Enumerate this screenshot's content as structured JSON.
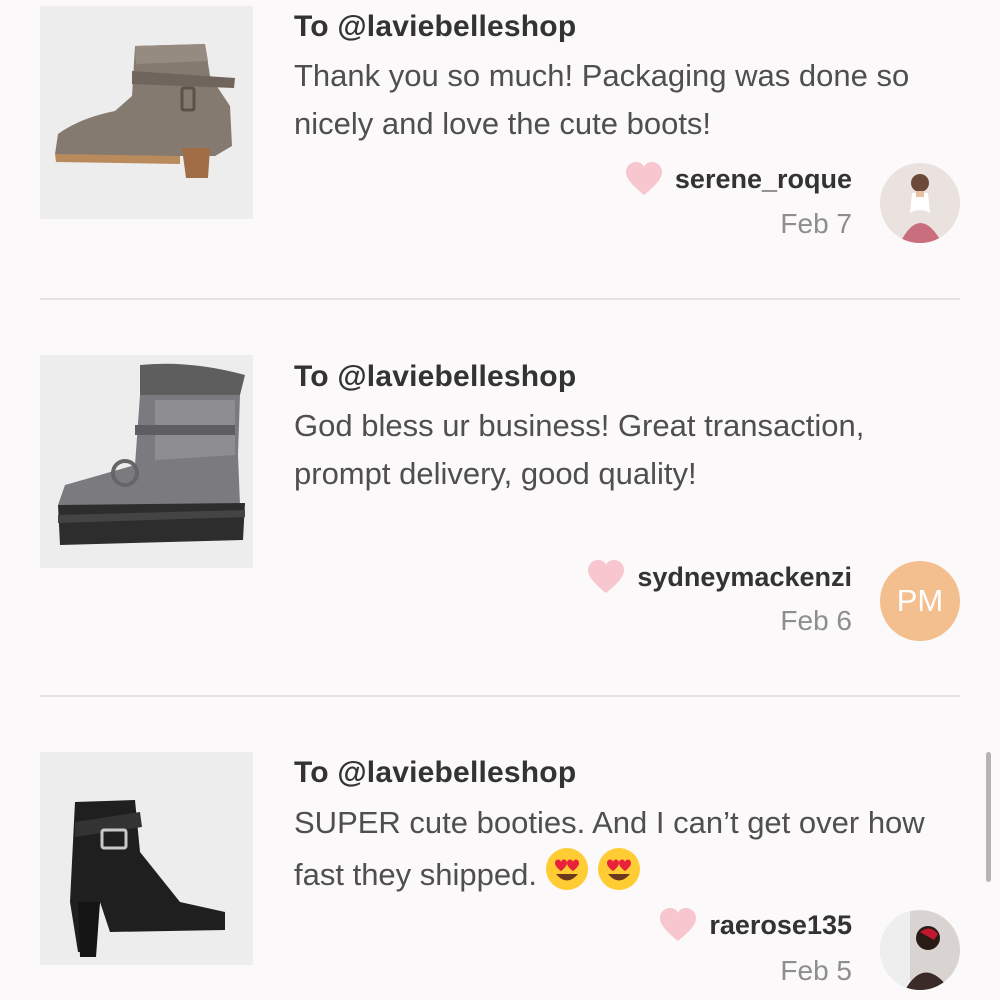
{
  "notes": [
    {
      "to": "To @laviebelleshop",
      "message": "Thank you so much! Packaging was done so nicely and love the cute boots!",
      "username": "serene_roque",
      "date": "Feb 7",
      "image": "taupe-ankle-boot",
      "avatar": "profile-photo"
    },
    {
      "to": "To @laviebelleshop",
      "message": "God bless ur business! Great transaction, prompt delivery, good quality!",
      "username": "sydneymackenzi",
      "date": "Feb 6",
      "image": "pewter-winter-boot",
      "avatar_initials": "PM"
    },
    {
      "to": "To @laviebelleshop",
      "message": "SUPER cute booties. And I can’t get over how fast they shipped.",
      "emoji": [
        "heart-eyes-emoji",
        "heart-eyes-emoji"
      ],
      "username": "raerose135",
      "date": "Feb 5",
      "image": "black-heeled-bootie",
      "avatar": "profile-photo"
    }
  ],
  "colors": {
    "heart": "#f7c6cf",
    "avatar_initials_bg": "#f3bf8f",
    "divider": "#e3e3e3",
    "date_text": "#8e8e8e"
  }
}
